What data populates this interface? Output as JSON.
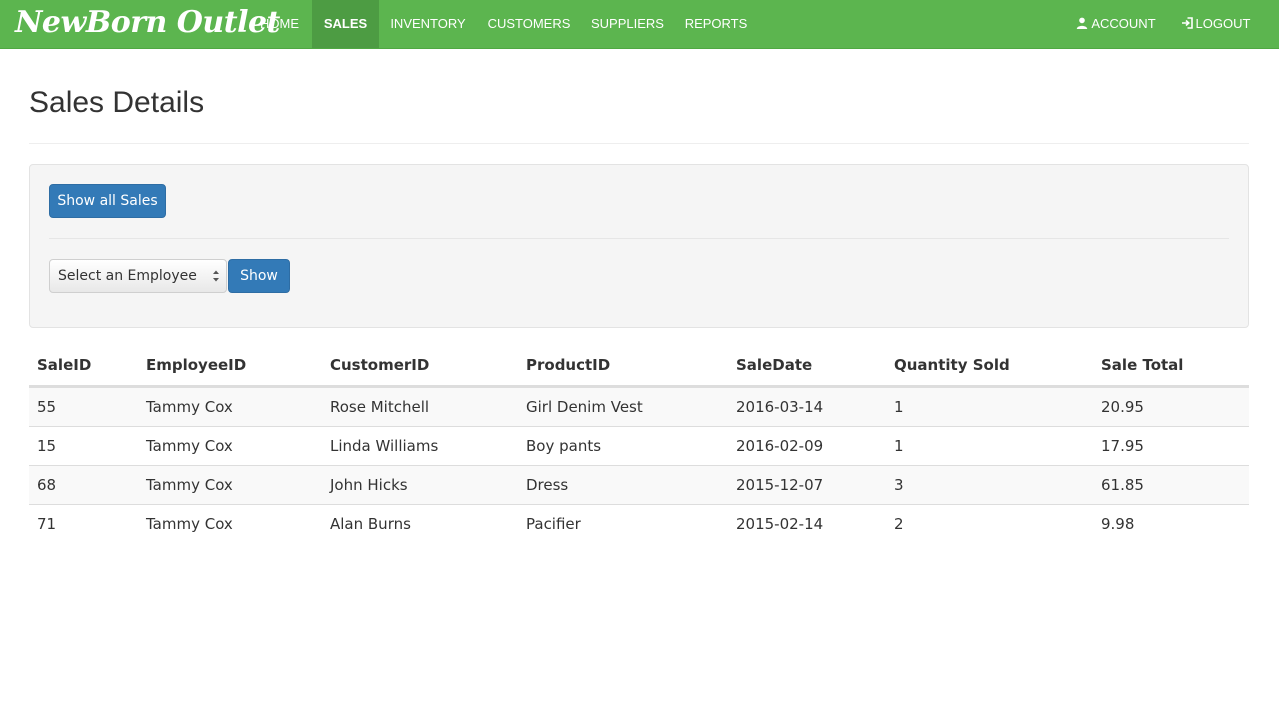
{
  "brand": "NewBorn Outlet",
  "nav": {
    "items": [
      {
        "label": "HOME"
      },
      {
        "label": "SALES"
      },
      {
        "label": "INVENTORY"
      },
      {
        "label": "CUSTOMERS"
      },
      {
        "label": "SUPPLIERS"
      },
      {
        "label": "REPORTS"
      }
    ],
    "active": "SALES",
    "account_label": "ACCOUNT",
    "logout_label": "LOGOUT"
  },
  "page": {
    "title": "Sales Details"
  },
  "filters": {
    "show_all_label": "Show all Sales",
    "employee_select_value": "Select an Employee",
    "show_label": "Show"
  },
  "table": {
    "headers": [
      "SaleID",
      "EmployeeID",
      "CustomerID",
      "ProductID",
      "SaleDate",
      "Quantity Sold",
      "Sale Total"
    ],
    "rows": [
      [
        "55",
        "Tammy Cox",
        "Rose Mitchell",
        "Girl Denim Vest",
        "2016-03-14",
        "1",
        "20.95"
      ],
      [
        "15",
        "Tammy Cox",
        "Linda Williams",
        "Boy pants",
        "2016-02-09",
        "1",
        "17.95"
      ],
      [
        "68",
        "Tammy Cox",
        "John Hicks",
        "Dress",
        "2015-12-07",
        "3",
        "61.85"
      ],
      [
        "71",
        "Tammy Cox",
        "Alan Burns",
        "Pacifier",
        "2015-02-14",
        "2",
        "9.98"
      ]
    ]
  },
  "colors": {
    "navbar": "#5cb54f",
    "navbar_active": "#4d9c43",
    "primary_button": "#337ab7"
  },
  "icons": {
    "account": "user-icon",
    "logout": "logout-icon",
    "select": "chevron-updown-icon"
  }
}
